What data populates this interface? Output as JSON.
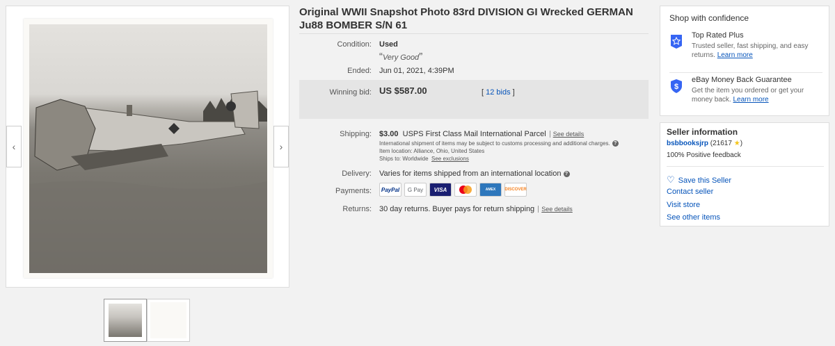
{
  "gallery": {
    "prev_label": "‹",
    "next_label": "›"
  },
  "listing": {
    "title": "Original WWII Snapshot Photo 83rd DIVISION GI Wrecked GERMAN Ju88 BOMBER S/N 61",
    "condition_label": "Condition:",
    "condition_value": "Used",
    "condition_note": "Very Good",
    "ended_label": "Ended:",
    "ended_value": "Jun 01, 2021, 4:39PM",
    "winning_bid_label": "Winning bid:",
    "winning_bid_value": "US $587.00",
    "bids_open": "[ ",
    "bids_link": "12 bids",
    "bids_close": " ]",
    "shipping_label": "Shipping:",
    "shipping_price": "$3.00",
    "shipping_method": "USPS First Class Mail International Parcel",
    "shipping_see_details": "See details",
    "shipping_intl_note": "International shipment of items may be subject to customs processing and additional charges.",
    "item_location": "Item location:  Alliance, Ohio, United States",
    "ships_to": "Ships to:  Worldwide",
    "see_exclusions": "See exclusions",
    "delivery_label": "Delivery:",
    "delivery_value": "Varies for items shipped from an international location",
    "payments_label": "Payments:",
    "payments": [
      {
        "name": "PayPal",
        "color": "#003087"
      },
      {
        "name": "G Pay",
        "color": "#5f6368"
      },
      {
        "name": "VISA",
        "color": "#1a1f71"
      },
      {
        "name": "Mastercard",
        "color": "#eb001b"
      },
      {
        "name": "American Express",
        "color": "#2e77bc"
      },
      {
        "name": "DISCOVER",
        "color": "#f58220"
      }
    ],
    "returns_label": "Returns:",
    "returns_value": "30 day returns. Buyer pays for return shipping",
    "returns_see_details": "See details"
  },
  "confidence": {
    "heading": "Shop with confidence",
    "top_rated_title": "Top Rated Plus",
    "top_rated_desc": "Trusted seller, fast shipping, and easy returns.",
    "top_rated_link": "Learn more",
    "guarantee_title": "eBay Money Back Guarantee",
    "guarantee_desc": "Get the item you ordered or get your money back.",
    "guarantee_link": "Learn more",
    "accent_color": "#3665f3"
  },
  "seller": {
    "heading": "Seller information",
    "username": "bsbbooksjrp",
    "feedback_open": "(21617 ",
    "feedback_close": ")",
    "positive": "100% Positive feedback",
    "save": "Save this Seller",
    "contact": "Contact seller",
    "store": "Visit store",
    "other_items": "See other items"
  }
}
